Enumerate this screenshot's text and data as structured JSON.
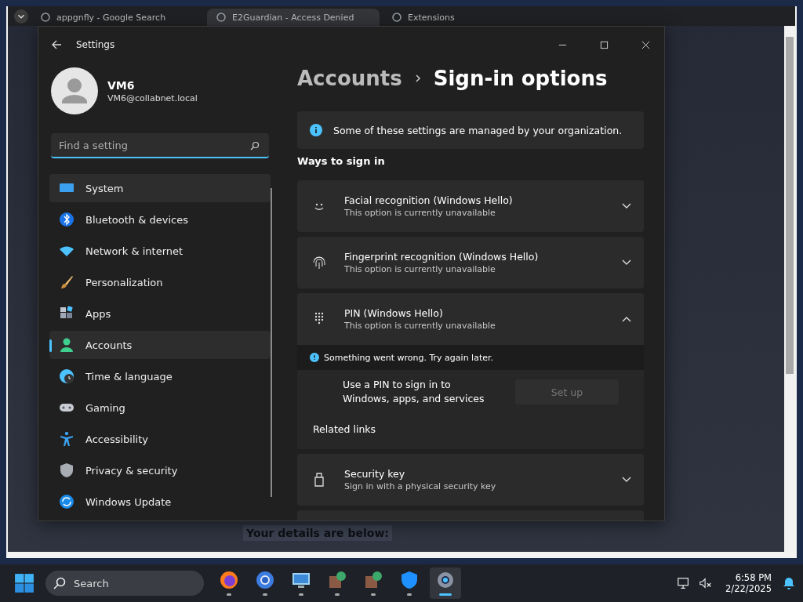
{
  "browser": {
    "tabs": [
      {
        "title": "appgnfly - Google Search",
        "selected": false
      },
      {
        "title": "E2Guardian - Access Denied",
        "selected": true
      },
      {
        "title": "Extensions",
        "selected": false
      }
    ],
    "page_text": "Your details are below:"
  },
  "settings": {
    "title": "Settings",
    "user": {
      "name": "VM6",
      "email": "VM6@collabnet.local"
    },
    "search": {
      "placeholder": "Find a setting"
    },
    "nav": [
      {
        "label": "System",
        "selected": false,
        "hovered": true
      },
      {
        "label": "Bluetooth & devices",
        "selected": false,
        "hovered": false
      },
      {
        "label": "Network & internet",
        "selected": false,
        "hovered": false
      },
      {
        "label": "Personalization",
        "selected": false,
        "hovered": false
      },
      {
        "label": "Apps",
        "selected": false,
        "hovered": false
      },
      {
        "label": "Accounts",
        "selected": true,
        "hovered": false
      },
      {
        "label": "Time & language",
        "selected": false,
        "hovered": false
      },
      {
        "label": "Gaming",
        "selected": false,
        "hovered": false
      },
      {
        "label": "Accessibility",
        "selected": false,
        "hovered": false
      },
      {
        "label": "Privacy & security",
        "selected": false,
        "hovered": false
      },
      {
        "label": "Windows Update",
        "selected": false,
        "hovered": false
      }
    ],
    "breadcrumb": {
      "parent": "Accounts",
      "current": "Sign-in options"
    },
    "banner": "Some of these settings are managed by your organization.",
    "section": "Ways to sign in",
    "options": [
      {
        "title": "Facial recognition (Windows Hello)",
        "subtitle": "This option is currently unavailable",
        "expanded": false
      },
      {
        "title": "Fingerprint recognition (Windows Hello)",
        "subtitle": "This option is currently unavailable",
        "expanded": false
      },
      {
        "title": "PIN (Windows Hello)",
        "subtitle": "This option is currently unavailable",
        "expanded": true,
        "error": "Something went wrong. Try again later.",
        "detail": "Use a PIN to sign in to Windows, apps, and services",
        "button": {
          "label": "Set up",
          "disabled": true
        },
        "related": "Related links"
      },
      {
        "title": "Security key",
        "subtitle": "Sign in with a physical security key",
        "expanded": false
      }
    ]
  },
  "taskbar": {
    "search_placeholder": "Search",
    "apps": [
      {
        "selected": false
      },
      {
        "selected": false
      },
      {
        "selected": false
      },
      {
        "selected": false
      },
      {
        "selected": false
      },
      {
        "selected": false
      },
      {
        "selected": true
      }
    ],
    "time": "6:58 PM",
    "date": "2/22/2025"
  }
}
